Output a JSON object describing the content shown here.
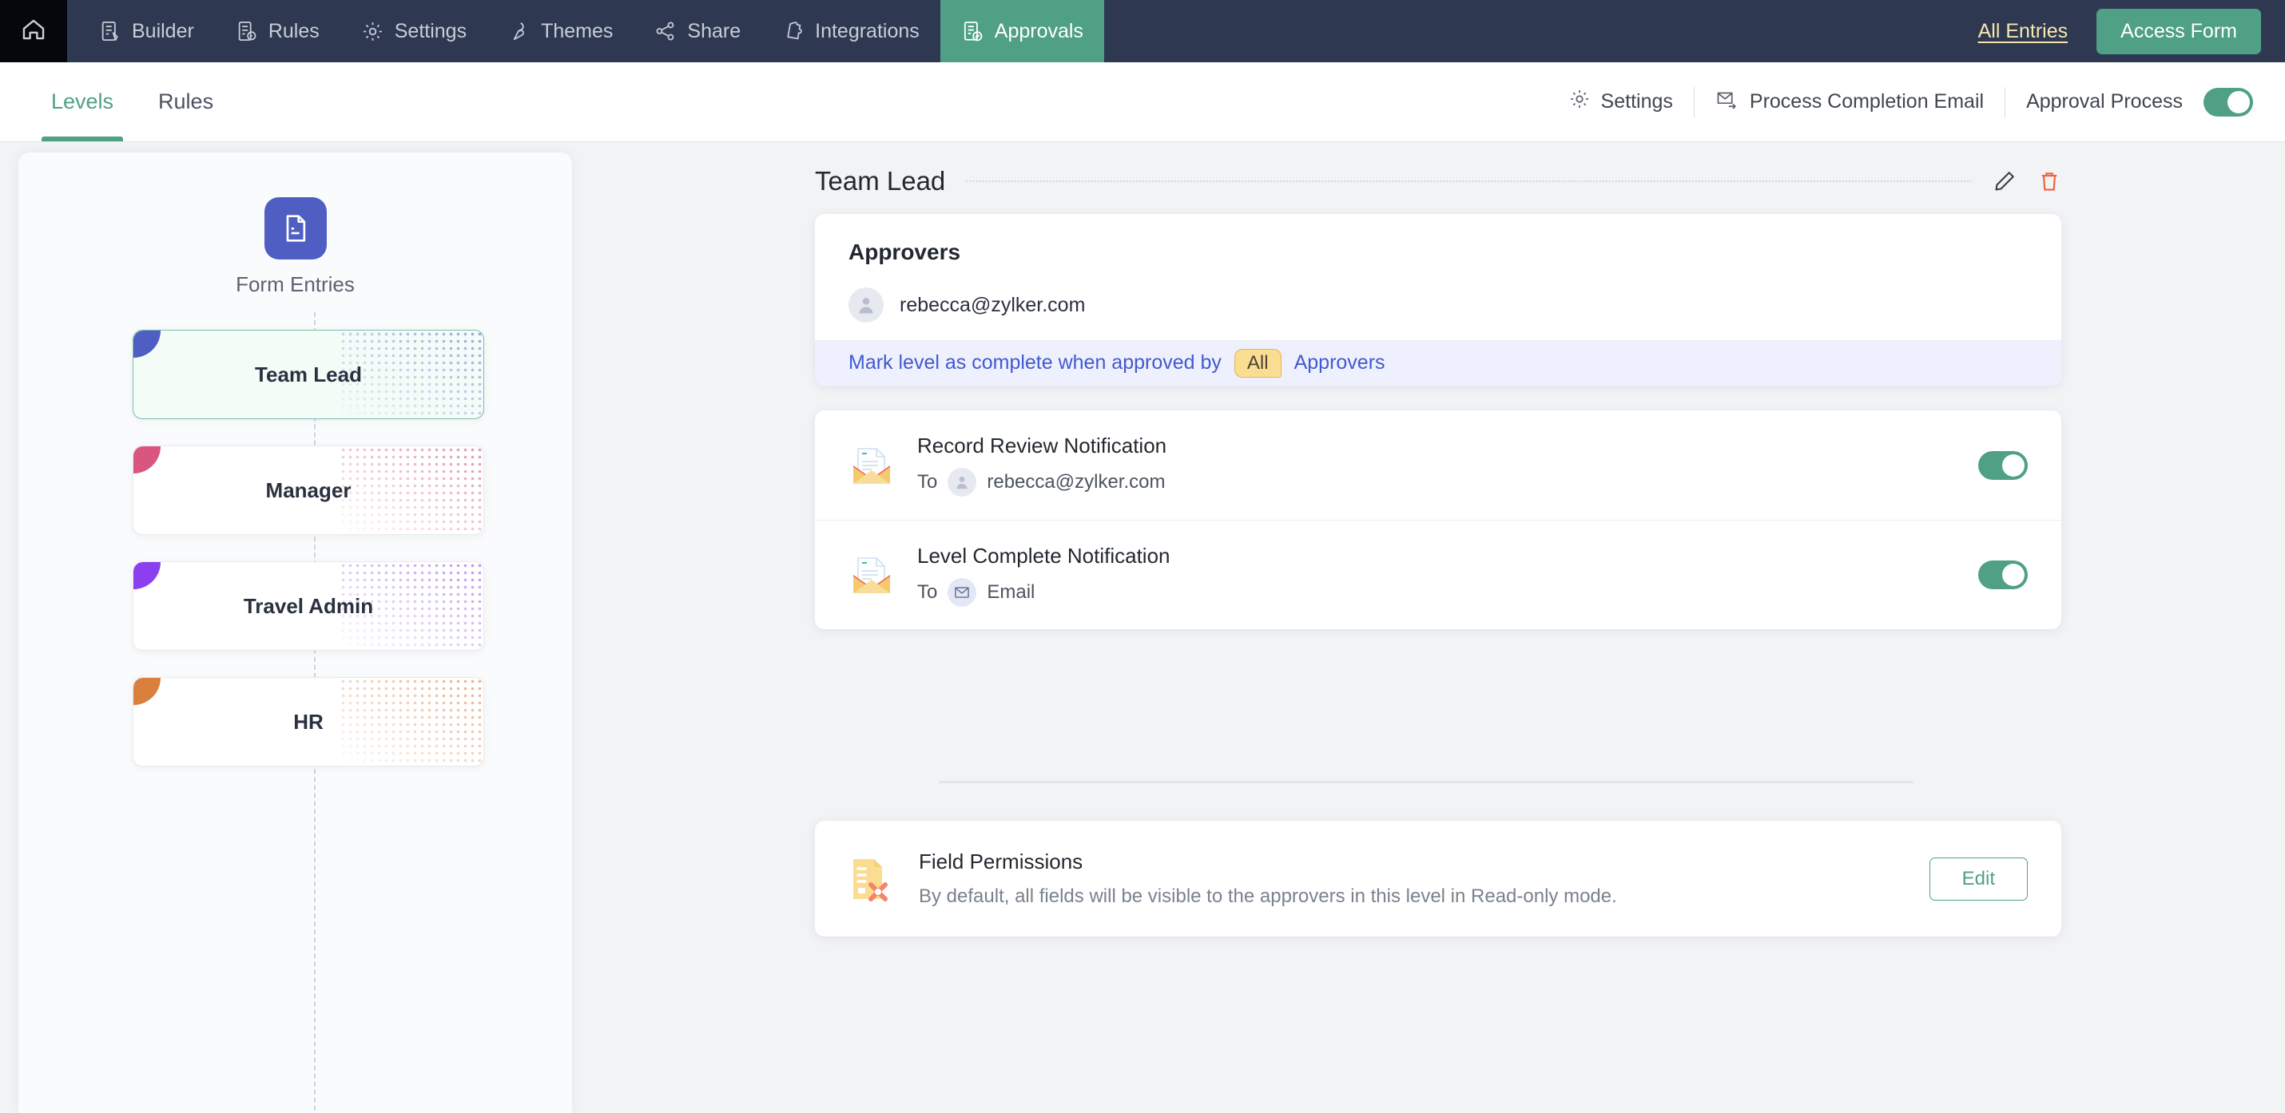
{
  "topnav": {
    "home_icon": "home-icon",
    "items": [
      {
        "label": "Builder",
        "icon": "form-builder-icon",
        "active": false
      },
      {
        "label": "Rules",
        "icon": "rules-doc-icon",
        "active": false
      },
      {
        "label": "Settings",
        "icon": "gear-icon",
        "active": false
      },
      {
        "label": "Themes",
        "icon": "brush-icon",
        "active": false
      },
      {
        "label": "Share",
        "icon": "share-nodes-icon",
        "active": false
      },
      {
        "label": "Integrations",
        "icon": "puzzle-icon",
        "active": false
      },
      {
        "label": "Approvals",
        "icon": "approval-check-icon",
        "active": true
      }
    ],
    "all_entries_label": "All Entries",
    "access_form_label": "Access Form",
    "bg_color": "#2e3951",
    "accent_color": "#4fa085",
    "link_color": "#f6e7b0"
  },
  "subbar": {
    "tabs": [
      {
        "label": "Levels",
        "active": true
      },
      {
        "label": "Rules",
        "active": false
      }
    ],
    "settings_label": "Settings",
    "process_completion_email_label": "Process Completion Email",
    "approval_process_label": "Approval Process",
    "approval_process_enabled": true
  },
  "levels": {
    "start_node": {
      "label": "Form Entries",
      "icon": "document-icon",
      "color": "#4f5ec2"
    },
    "cards": [
      {
        "label": "Team Lead",
        "color": "#4f5ec2",
        "selected": true
      },
      {
        "label": "Manager",
        "color": "#d9567f",
        "selected": false
      },
      {
        "label": "Travel Admin",
        "color": "#8a3ff0",
        "selected": false
      },
      {
        "label": "HR",
        "color": "#d9803f",
        "selected": false
      }
    ]
  },
  "detail": {
    "title": "Team Lead",
    "edit_icon": "pencil-icon",
    "delete_icon": "trash-icon",
    "approvers": {
      "heading": "Approvers",
      "list": [
        {
          "email": "rebecca@zylker.com",
          "avatar": "user-avatar-icon"
        }
      ],
      "mark_prefix": "Mark level as complete when approved by",
      "mark_badge": "All",
      "mark_suffix": "Approvers"
    },
    "notifications": [
      {
        "title": "Record Review Notification",
        "to_label": "To",
        "to_value": "rebecca@zylker.com",
        "to_icon": "user-avatar-icon",
        "enabled": true
      },
      {
        "title": "Level Complete Notification",
        "to_label": "To",
        "to_value": "Email",
        "to_icon": "envelope-icon",
        "enabled": true
      }
    ],
    "field_permissions": {
      "title": "Field Permissions",
      "description": "By default, all fields will be visible to the approvers in this level in Read-only mode.",
      "edit_label": "Edit",
      "icon": "permissions-icon"
    }
  }
}
